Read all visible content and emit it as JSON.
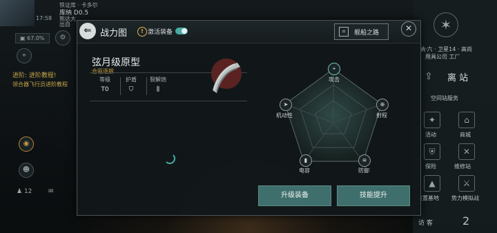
{
  "background": {
    "player": {
      "rank_text": "铁证库 · 卡多尔",
      "name": "库纳",
      "level": "0.5",
      "level_prefix": "D",
      "sub_text": "熊达大",
      "sub_text2": "出自",
      "coords": "17:58",
      "badge_value": "67.0%"
    },
    "task_title": "进阶: 进阶教程!",
    "task_desc": "领合器飞行员进阶教程",
    "counter_value": "12",
    "right_panel": {
      "location_line1": "纳·六 · 卫星14 · 高尚",
      "location_line2": "用具公司 工厂",
      "leave_station": "离 站",
      "station_services": "空间站服务",
      "items": [
        "活动",
        "商城",
        "保险",
        "维修站",
        "设置基地",
        "势力模拟战"
      ],
      "visitor": "访 客",
      "visitor_count": "2"
    }
  },
  "dialog": {
    "title": "战力图",
    "activate_label": "激活装备",
    "activate_on": true,
    "ship_road_label": "舰船之路",
    "ship": {
      "name": "弦月级原型",
      "class": "合驱逐舰",
      "stats": [
        {
          "label": "等级",
          "value": "T0"
        },
        {
          "label": "护盾",
          "value": "shield-icon"
        },
        {
          "label": "裂解炮",
          "value": "cannon-icon"
        }
      ]
    },
    "radar": {
      "labels": {
        "attack": "攻击",
        "range": "射程",
        "defense": "防御",
        "capacity": "电容",
        "mobility": "机动性"
      }
    },
    "upgrade_button": "升级装备",
    "skill_button": "技能提升"
  }
}
